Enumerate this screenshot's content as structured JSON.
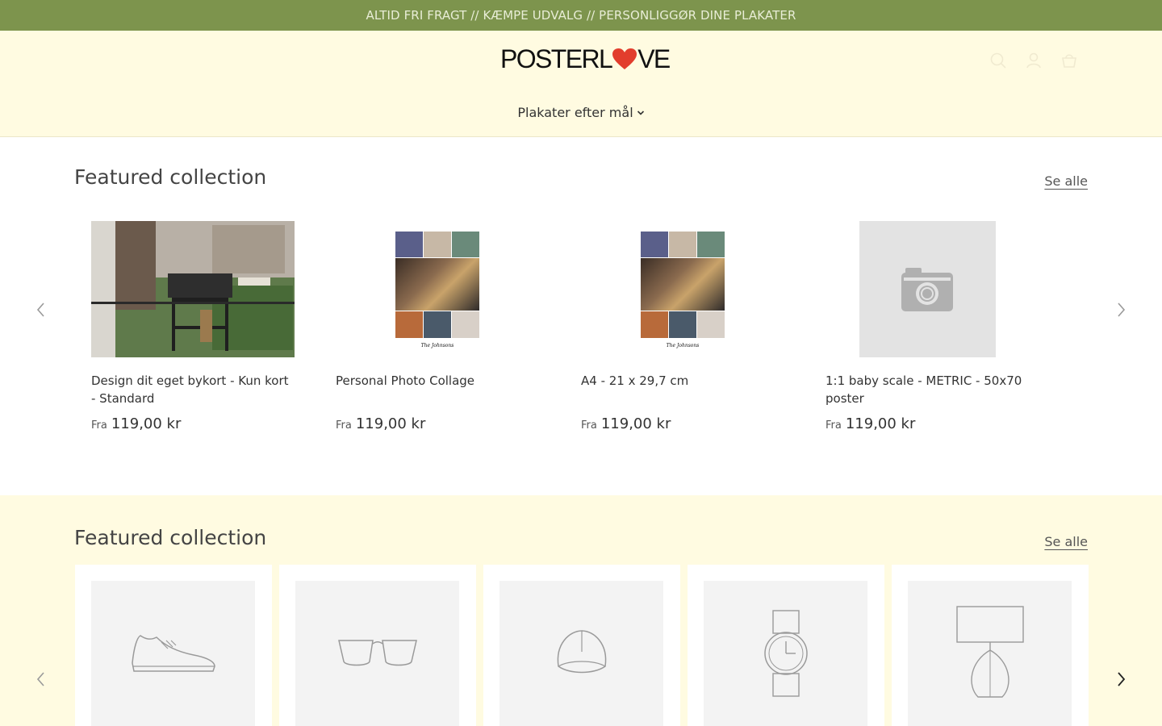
{
  "announcement": {
    "text": "ALTID FRI FRAGT // KÆMPE UDVALG // PERSONLIGGØR DINE PLAKATER"
  },
  "header": {
    "logo_left": "POSTERL",
    "logo_right": "VE",
    "nav": [
      {
        "label": "Plakater efter mål"
      }
    ]
  },
  "colors": {
    "accent": "#7d944d",
    "cream": "#fffbe1",
    "heart": "#e23d2d"
  },
  "section1": {
    "title": "Featured collection",
    "see_all": "Se alle",
    "products": [
      {
        "name": "Design dit eget bykort - Kun kort - Standard",
        "from": "Fra",
        "price": "119,00 kr"
      },
      {
        "name": "Personal Photo Collage",
        "from": "Fra",
        "price": "119,00 kr",
        "caption": "The Johnsons"
      },
      {
        "name": "A4 - 21 x 29,7 cm",
        "from": "Fra",
        "price": "119,00 kr",
        "caption": "The Johnsons"
      },
      {
        "name": "1:1 baby scale - METRIC - 50x70 poster",
        "from": "Fra",
        "price": "119,00 kr"
      }
    ]
  },
  "section2": {
    "title": "Featured collection",
    "see_all": "Se alle",
    "placeholders": [
      "shoe-icon",
      "glasses-icon",
      "cap-icon",
      "watch-icon",
      "lamp-icon"
    ]
  },
  "icons": [
    "search-icon",
    "account-icon",
    "cart-icon",
    "heart-icon",
    "chevron-down-icon",
    "chevron-left-icon",
    "chevron-right-icon",
    "camera-icon"
  ]
}
